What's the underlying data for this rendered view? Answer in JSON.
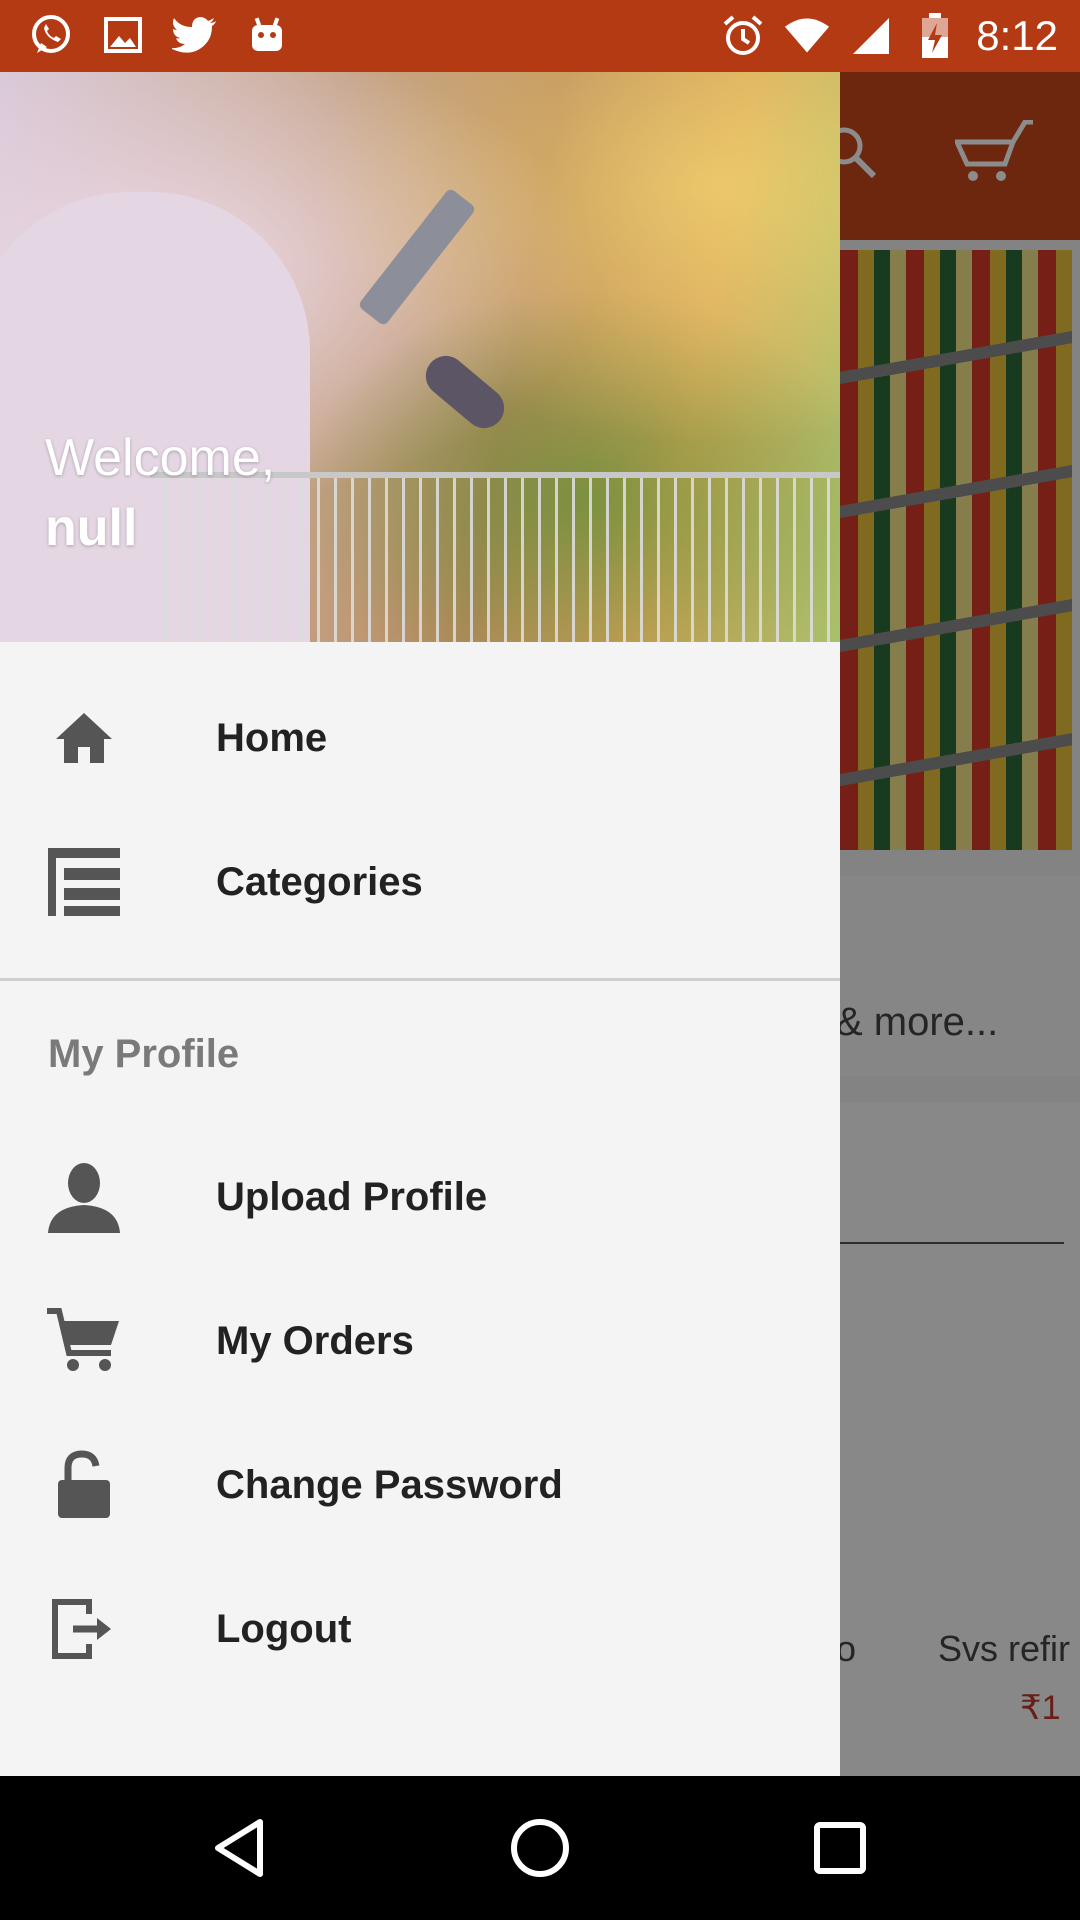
{
  "status_bar": {
    "time": "8:12",
    "left_icons": [
      "whatsapp-icon",
      "gallery-icon",
      "twitter-icon",
      "android-icon"
    ],
    "right_icons": [
      "alarm-icon",
      "wifi-icon",
      "signal-icon",
      "battery-charging-icon"
    ],
    "color": "#b43a14"
  },
  "drawer": {
    "welcome_text": "Welcome,",
    "username": "null",
    "menu_items": [
      {
        "label": "Home",
        "icon": "home-icon"
      },
      {
        "label": "Categories",
        "icon": "categories-icon"
      }
    ],
    "profile_section_title": "My Profile",
    "profile_items": [
      {
        "label": "Upload Profile",
        "icon": "person-icon"
      },
      {
        "label": "My Orders",
        "icon": "cart-icon"
      },
      {
        "label": "Change Password",
        "icon": "unlock-icon"
      },
      {
        "label": "Logout",
        "icon": "logout-icon"
      }
    ]
  },
  "background_app": {
    "toolbar_color": "#c5471a",
    "more_text": "& more...",
    "product_name": "Svs refir",
    "product_price": "₹1",
    "peek_text": "o"
  },
  "nav_bar": {
    "buttons": [
      "back-icon",
      "home-circle-icon",
      "recents-icon"
    ]
  }
}
